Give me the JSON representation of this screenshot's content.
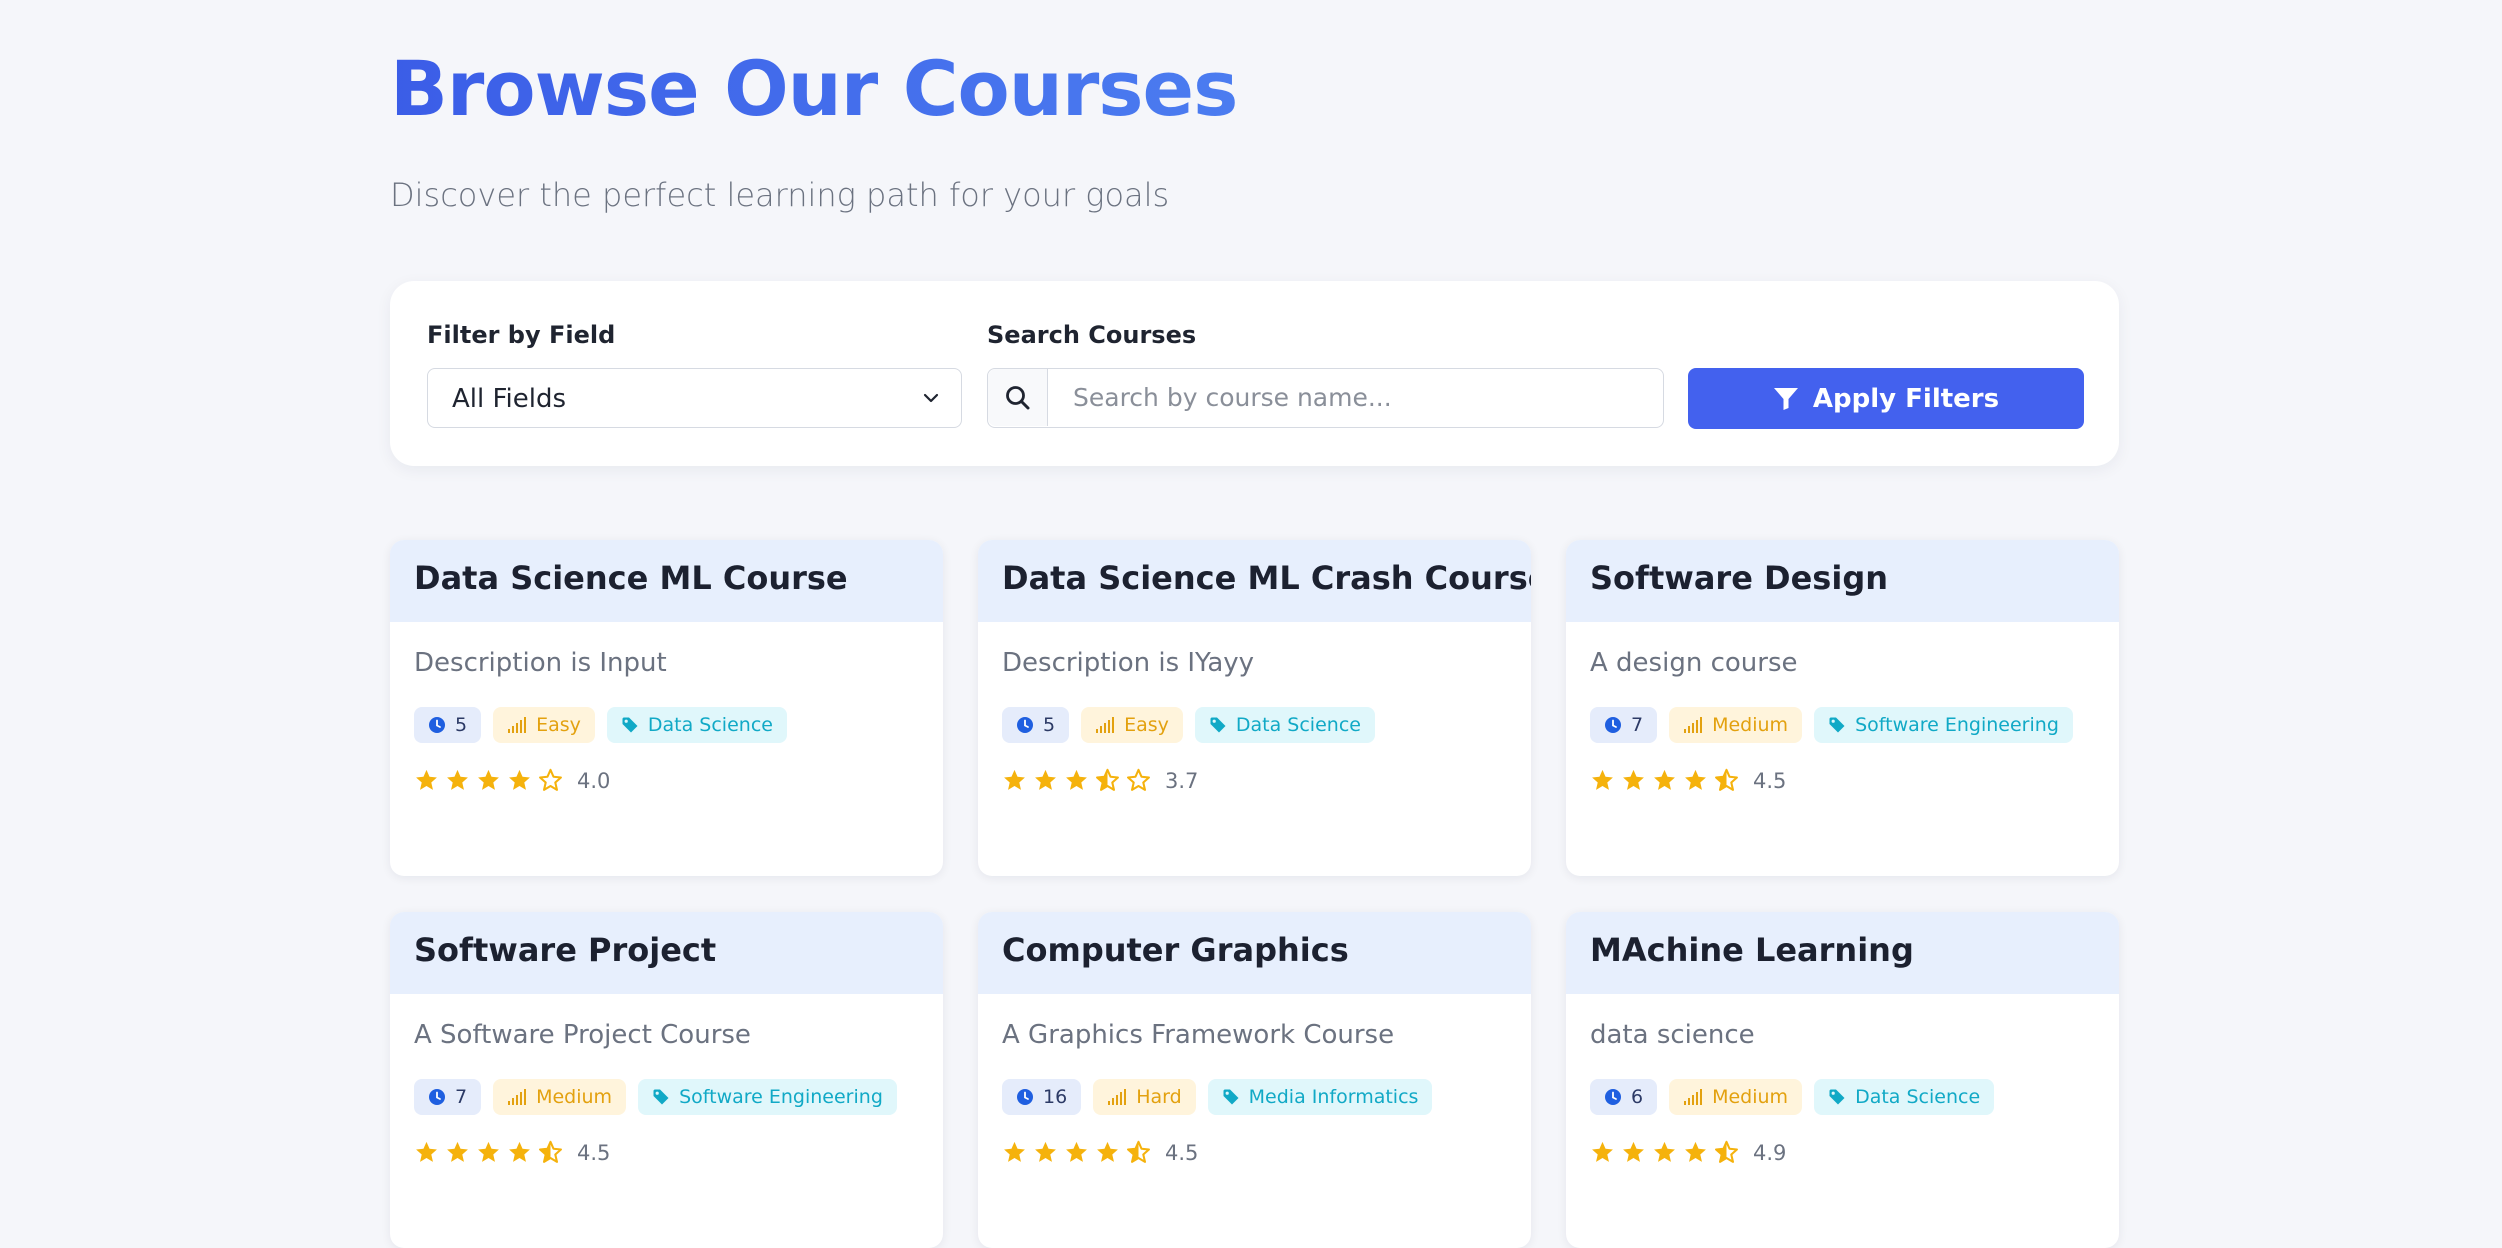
{
  "header": {
    "title": "Browse Our Courses",
    "subtitle": "Discover the perfect learning path for your goals"
  },
  "filters": {
    "field_label": "Filter by Field",
    "field_value": "All Fields",
    "search_label": "Search Courses",
    "search_placeholder": "Search by course name...",
    "apply_label": "Apply Filters"
  },
  "colors": {
    "accent": "#4361ee",
    "card_header": "#e7effd",
    "star": "#f5b20c"
  },
  "courses": [
    {
      "title": "Data Science ML Course",
      "description": "Description is Input",
      "duration": "5",
      "difficulty": "Easy",
      "field": "Data Science",
      "rating": 4.0,
      "rating_label": "4.0"
    },
    {
      "title": "Data Science ML Crash Course",
      "description": "Description is IYayy",
      "duration": "5",
      "difficulty": "Easy",
      "field": "Data Science",
      "rating": 3.7,
      "rating_label": "3.7"
    },
    {
      "title": "Software Design",
      "description": "A design course",
      "duration": "7",
      "difficulty": "Medium",
      "field": "Software Engineering",
      "rating": 4.5,
      "rating_label": "4.5"
    },
    {
      "title": "Software Project",
      "description": "A Software Project Course",
      "duration": "7",
      "difficulty": "Medium",
      "field": "Software Engineering",
      "rating": 4.5,
      "rating_label": "4.5"
    },
    {
      "title": "Computer Graphics",
      "description": "A Graphics Framework Course",
      "duration": "16",
      "difficulty": "Hard",
      "field": "Media Informatics",
      "rating": 4.5,
      "rating_label": "4.5"
    },
    {
      "title": "MAchine Learning",
      "description": "data science",
      "duration": "6",
      "difficulty": "Medium",
      "field": "Data Science",
      "rating": 4.9,
      "rating_label": "4.9"
    }
  ]
}
